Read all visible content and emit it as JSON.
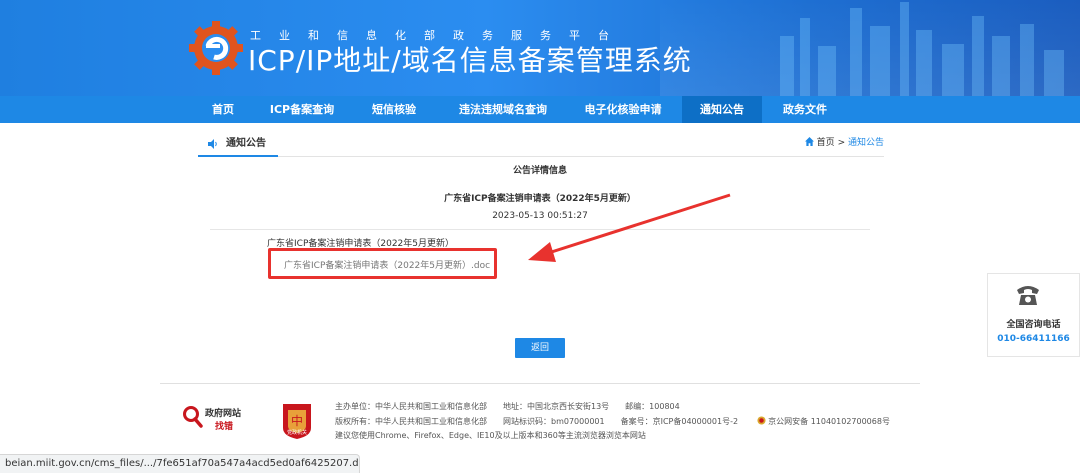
{
  "header": {
    "subtitle": "工业和信息化部政务服务平台",
    "title": "ICP/IP地址/域名信息备案管理系统"
  },
  "nav": {
    "items": [
      {
        "label": "首页"
      },
      {
        "label": "ICP备案查询"
      },
      {
        "label": "短信核验"
      },
      {
        "label": "违法违规域名查询"
      },
      {
        "label": "电子化核验申请"
      },
      {
        "label": "通知公告",
        "active": true
      },
      {
        "label": "政务文件"
      }
    ]
  },
  "breadcrumb": {
    "tab_label": "通知公告",
    "home": "首页",
    "separator": ">",
    "current": "通知公告"
  },
  "notice": {
    "section_heading": "公告详情信息",
    "title": "广东省ICP备案注销申请表（2022年5月更新）",
    "date": "2023-05-13 00:51:27",
    "body_line": "广东省ICP备案注销申请表（2022年5月更新）",
    "attachment": "广东省ICP备案注销申请表（2022年5月更新）.doc",
    "back_label": "返回"
  },
  "contact": {
    "label": "全国咨询电话",
    "number": "010-66411166"
  },
  "footer": {
    "gov_site_label": "政府网站",
    "gov_site_sub": "找错",
    "party_label": "党政机关",
    "line1": "主办单位：中华人民共和国工业和信息化部　　地址：中国北京西长安街13号　　邮编：100804",
    "line2_a": "版权所有：中华人民共和国工业和信息化部　　网站标识码：bm07000001　　备案号：京ICP备04000001号-2",
    "line2_b": "京公网安备 11040102700068号",
    "line3": "建议您使用Chrome、Firefox、Edge、IE10及以上版本和360等主流浏览器浏览本网站"
  },
  "status_url": "beian.miit.gov.cn/cms_files/.../7fe651af70a547a4acd5ed0af6425207.doc",
  "colors": {
    "brand_blue": "#1e88e5",
    "highlight_red": "#e8322e"
  }
}
